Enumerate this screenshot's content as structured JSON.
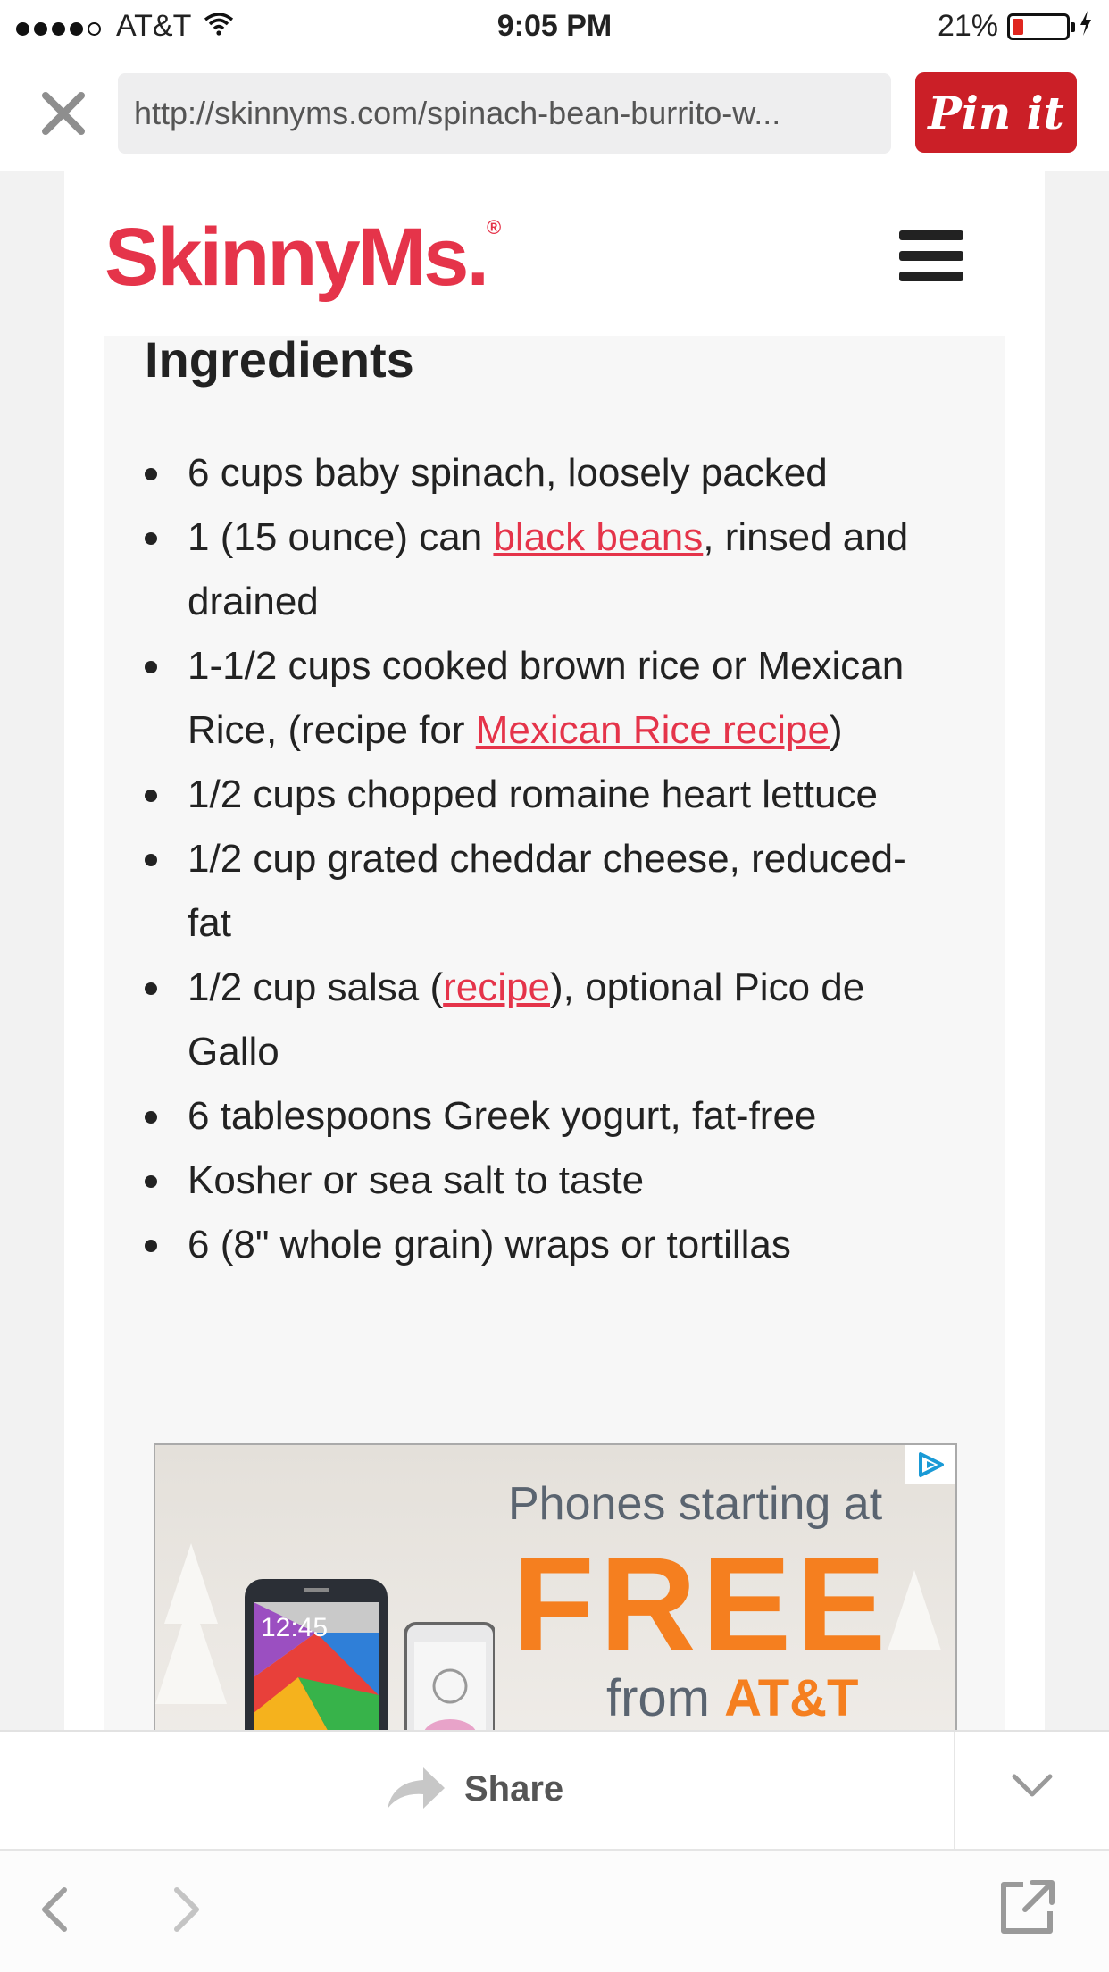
{
  "status_bar": {
    "carrier": "AT&T",
    "time": "9:05 PM",
    "battery_percent": "21%",
    "battery_level": 0.21,
    "signal_bars": 4,
    "signal_max": 5
  },
  "browser": {
    "url": "http://skinnyms.com/spinach-bean-burrito-w...",
    "pin_label": "Pin it"
  },
  "site": {
    "logo": "SkinnyMs.",
    "logo_mark": "®"
  },
  "recipe": {
    "section_title": "Ingredients",
    "items": [
      {
        "pre": "6 cups baby spinach, loosely packed",
        "link": "",
        "post": ""
      },
      {
        "pre": "1 (15 ounce) can ",
        "link": "black beans",
        "post": ", rinsed and drained"
      },
      {
        "pre": "1-1/2 cups cooked brown rice or Mexican Rice, (recipe for ",
        "link": "Mexican Rice recipe",
        "post": ")"
      },
      {
        "pre": "1/2 cups chopped romaine heart lettuce",
        "link": "",
        "post": ""
      },
      {
        "pre": "1/2 cup grated cheddar cheese, reduced-fat",
        "link": "",
        "post": ""
      },
      {
        "pre": "1/2 cup salsa (",
        "link": "recipe",
        "post": "), optional Pico de Gallo"
      },
      {
        "pre": "6 tablespoons Greek yogurt, fat-free",
        "link": "",
        "post": ""
      },
      {
        "pre": "Kosher or sea salt to taste",
        "link": "",
        "post": ""
      },
      {
        "pre": "6 (8\" whole grain) wraps or tortillas",
        "link": "",
        "post": ""
      }
    ]
  },
  "ad": {
    "line1": "Phones starting at",
    "line2": "FREE",
    "line3_prefix": "from ",
    "line3_brand": "AT&T",
    "phone_time": "12:45"
  },
  "share_bar": {
    "share_label": "Share"
  },
  "colors": {
    "brand_red": "#e5344a",
    "pin_red": "#cb1f27",
    "ad_orange": "#f57f1f"
  }
}
